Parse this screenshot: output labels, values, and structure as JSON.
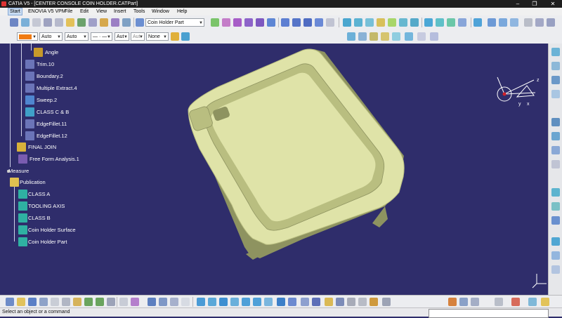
{
  "window": {
    "title": "CATIA V5 - [CENTER CONSOLE COIN HOLDER.CATPart]",
    "controls": [
      "–",
      "❐",
      "✕"
    ]
  },
  "menu": {
    "items": [
      "Start",
      "ENOVIA V5 VPM",
      "File",
      "Edit",
      "View",
      "Insert",
      "Tools",
      "Window",
      "Help"
    ]
  },
  "toolbar1": {
    "current_part": "Coin Holder Part"
  },
  "toolbar2": {
    "fill_color": "#f07b12",
    "transparency": "Auto",
    "line_thickness": "Auto",
    "line_type": "— · — ·",
    "point_symbol": "Aut",
    "rendering_style": "Aut",
    "layer": "None"
  },
  "tree": {
    "items": [
      {
        "label": "Angle",
        "color": "#c79a2a"
      },
      {
        "label": "Trim.10",
        "color": "#6b74b8"
      },
      {
        "label": "Boundary.2",
        "color": "#6b74b8"
      },
      {
        "label": "Multiple Extract.4",
        "color": "#6b74b8"
      },
      {
        "label": "Sweep.2",
        "color": "#4f86d0"
      },
      {
        "label": "CLASS C & B",
        "color": "#3fa0c8"
      },
      {
        "label": "EdgeFillet.11",
        "color": "#6b74b8"
      },
      {
        "label": "EdgeFillet.12",
        "color": "#6b74b8"
      },
      {
        "label": "FINAL JOIN",
        "color": "#d8b23a"
      },
      {
        "label": "Free Form Analysis.1",
        "color": "#7a5cb0"
      },
      {
        "label": "Measure",
        "color": "#c0c0c0"
      },
      {
        "label": "Publication",
        "color": "#e0c050"
      },
      {
        "label": "CLASS A",
        "color": "#2fb1a2"
      },
      {
        "label": "TOOLING AXIS",
        "color": "#2fb1a2"
      },
      {
        "label": "CLASS B",
        "color": "#2fb1a2"
      },
      {
        "label": "Coin Holder Surface",
        "color": "#2fb1a2"
      },
      {
        "label": "Coin Holder Part",
        "color": "#2fb1a2"
      }
    ]
  },
  "compass": {
    "axes": [
      "z",
      "y",
      "x"
    ]
  },
  "model": {
    "fill": "#dfe3a8",
    "shade": "#b9be80",
    "dark": "#8e9360"
  },
  "status": {
    "message": "Select an object or a command",
    "command_value": ""
  },
  "colors": {
    "background": "#2f2d6b",
    "toolbar": "#ecedf0"
  }
}
